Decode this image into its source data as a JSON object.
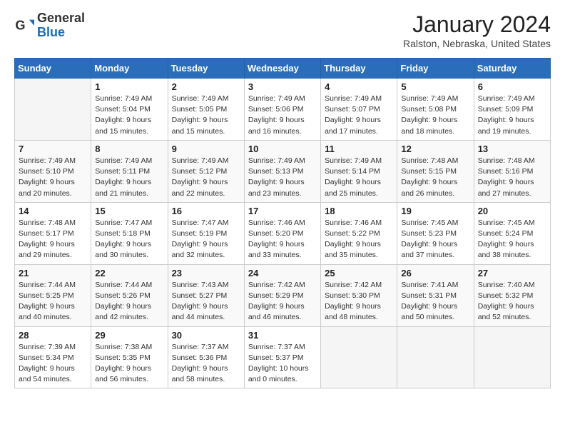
{
  "header": {
    "logo_line1": "General",
    "logo_line2": "Blue",
    "month_title": "January 2024",
    "location": "Ralston, Nebraska, United States"
  },
  "weekdays": [
    "Sunday",
    "Monday",
    "Tuesday",
    "Wednesday",
    "Thursday",
    "Friday",
    "Saturday"
  ],
  "weeks": [
    [
      {
        "day": "",
        "detail": ""
      },
      {
        "day": "1",
        "detail": "Sunrise: 7:49 AM\nSunset: 5:04 PM\nDaylight: 9 hours\nand 15 minutes."
      },
      {
        "day": "2",
        "detail": "Sunrise: 7:49 AM\nSunset: 5:05 PM\nDaylight: 9 hours\nand 15 minutes."
      },
      {
        "day": "3",
        "detail": "Sunrise: 7:49 AM\nSunset: 5:06 PM\nDaylight: 9 hours\nand 16 minutes."
      },
      {
        "day": "4",
        "detail": "Sunrise: 7:49 AM\nSunset: 5:07 PM\nDaylight: 9 hours\nand 17 minutes."
      },
      {
        "day": "5",
        "detail": "Sunrise: 7:49 AM\nSunset: 5:08 PM\nDaylight: 9 hours\nand 18 minutes."
      },
      {
        "day": "6",
        "detail": "Sunrise: 7:49 AM\nSunset: 5:09 PM\nDaylight: 9 hours\nand 19 minutes."
      }
    ],
    [
      {
        "day": "7",
        "detail": "Sunrise: 7:49 AM\nSunset: 5:10 PM\nDaylight: 9 hours\nand 20 minutes."
      },
      {
        "day": "8",
        "detail": "Sunrise: 7:49 AM\nSunset: 5:11 PM\nDaylight: 9 hours\nand 21 minutes."
      },
      {
        "day": "9",
        "detail": "Sunrise: 7:49 AM\nSunset: 5:12 PM\nDaylight: 9 hours\nand 22 minutes."
      },
      {
        "day": "10",
        "detail": "Sunrise: 7:49 AM\nSunset: 5:13 PM\nDaylight: 9 hours\nand 23 minutes."
      },
      {
        "day": "11",
        "detail": "Sunrise: 7:49 AM\nSunset: 5:14 PM\nDaylight: 9 hours\nand 25 minutes."
      },
      {
        "day": "12",
        "detail": "Sunrise: 7:48 AM\nSunset: 5:15 PM\nDaylight: 9 hours\nand 26 minutes."
      },
      {
        "day": "13",
        "detail": "Sunrise: 7:48 AM\nSunset: 5:16 PM\nDaylight: 9 hours\nand 27 minutes."
      }
    ],
    [
      {
        "day": "14",
        "detail": "Sunrise: 7:48 AM\nSunset: 5:17 PM\nDaylight: 9 hours\nand 29 minutes."
      },
      {
        "day": "15",
        "detail": "Sunrise: 7:47 AM\nSunset: 5:18 PM\nDaylight: 9 hours\nand 30 minutes."
      },
      {
        "day": "16",
        "detail": "Sunrise: 7:47 AM\nSunset: 5:19 PM\nDaylight: 9 hours\nand 32 minutes."
      },
      {
        "day": "17",
        "detail": "Sunrise: 7:46 AM\nSunset: 5:20 PM\nDaylight: 9 hours\nand 33 minutes."
      },
      {
        "day": "18",
        "detail": "Sunrise: 7:46 AM\nSunset: 5:22 PM\nDaylight: 9 hours\nand 35 minutes."
      },
      {
        "day": "19",
        "detail": "Sunrise: 7:45 AM\nSunset: 5:23 PM\nDaylight: 9 hours\nand 37 minutes."
      },
      {
        "day": "20",
        "detail": "Sunrise: 7:45 AM\nSunset: 5:24 PM\nDaylight: 9 hours\nand 38 minutes."
      }
    ],
    [
      {
        "day": "21",
        "detail": "Sunrise: 7:44 AM\nSunset: 5:25 PM\nDaylight: 9 hours\nand 40 minutes."
      },
      {
        "day": "22",
        "detail": "Sunrise: 7:44 AM\nSunset: 5:26 PM\nDaylight: 9 hours\nand 42 minutes."
      },
      {
        "day": "23",
        "detail": "Sunrise: 7:43 AM\nSunset: 5:27 PM\nDaylight: 9 hours\nand 44 minutes."
      },
      {
        "day": "24",
        "detail": "Sunrise: 7:42 AM\nSunset: 5:29 PM\nDaylight: 9 hours\nand 46 minutes."
      },
      {
        "day": "25",
        "detail": "Sunrise: 7:42 AM\nSunset: 5:30 PM\nDaylight: 9 hours\nand 48 minutes."
      },
      {
        "day": "26",
        "detail": "Sunrise: 7:41 AM\nSunset: 5:31 PM\nDaylight: 9 hours\nand 50 minutes."
      },
      {
        "day": "27",
        "detail": "Sunrise: 7:40 AM\nSunset: 5:32 PM\nDaylight: 9 hours\nand 52 minutes."
      }
    ],
    [
      {
        "day": "28",
        "detail": "Sunrise: 7:39 AM\nSunset: 5:34 PM\nDaylight: 9 hours\nand 54 minutes."
      },
      {
        "day": "29",
        "detail": "Sunrise: 7:38 AM\nSunset: 5:35 PM\nDaylight: 9 hours\nand 56 minutes."
      },
      {
        "day": "30",
        "detail": "Sunrise: 7:37 AM\nSunset: 5:36 PM\nDaylight: 9 hours\nand 58 minutes."
      },
      {
        "day": "31",
        "detail": "Sunrise: 7:37 AM\nSunset: 5:37 PM\nDaylight: 10 hours\nand 0 minutes."
      },
      {
        "day": "",
        "detail": ""
      },
      {
        "day": "",
        "detail": ""
      },
      {
        "day": "",
        "detail": ""
      }
    ]
  ]
}
